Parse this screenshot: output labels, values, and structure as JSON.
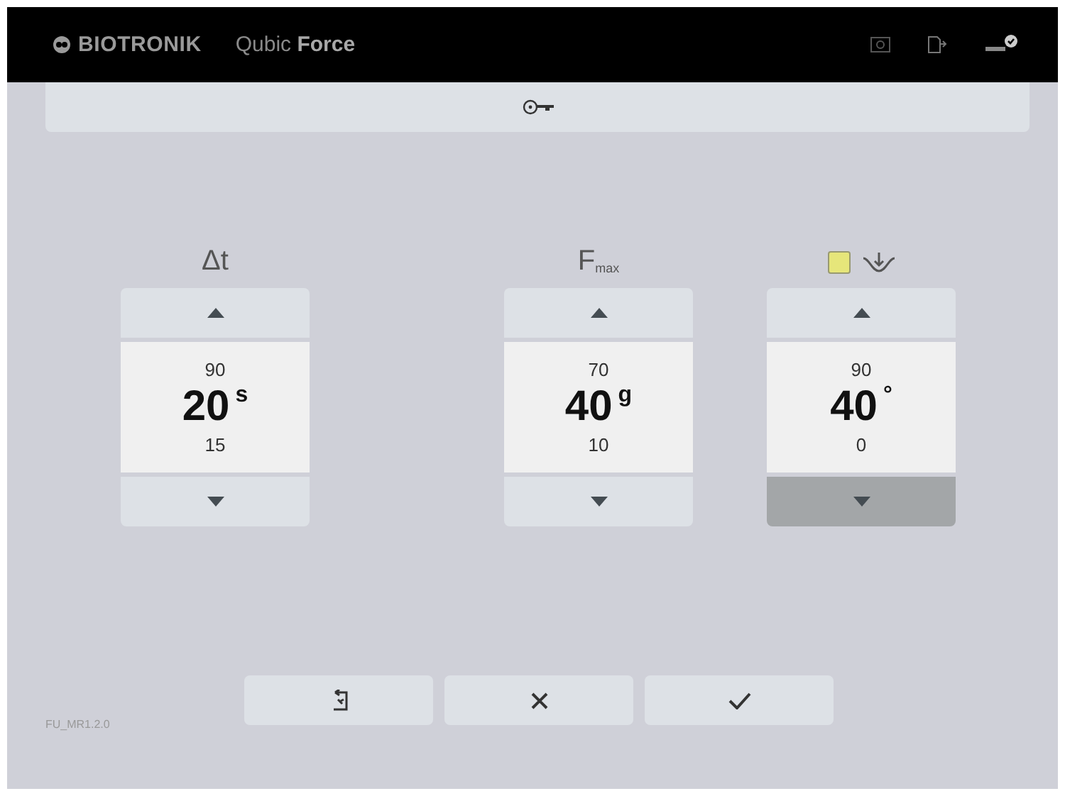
{
  "header": {
    "brand": "BIOTRONIK",
    "product": "Qubic **Force**"
  },
  "spinners": [
    {
      "label": "Δt",
      "kind": "text",
      "upper": "90",
      "value": "20",
      "unit": "s",
      "lower": "15",
      "down_pressed": false
    },
    {
      "label": "F$_{max}$",
      "kind": "text",
      "upper": "70",
      "value": "40",
      "unit": "g",
      "lower": "10",
      "down_pressed": false
    },
    {
      "kind": "icon",
      "indicator": {
        "color": "#e6e67a"
      },
      "upper": "90",
      "value": "40",
      "unit": "°",
      "lower": "0",
      "down_pressed": true
    }
  ],
  "version": "FU_MR1.2.0",
  "actions": [
    {
      "kind": "reset"
    },
    {
      "kind": "cancel"
    },
    {
      "kind": "confirm"
    }
  ]
}
